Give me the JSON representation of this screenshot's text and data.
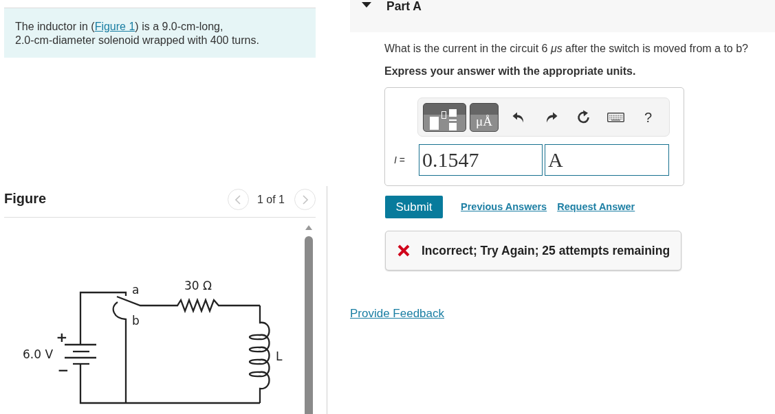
{
  "problem": {
    "text_before": "The inductor in (",
    "link": "Figure 1",
    "text_after": ") is a 9.0-cm-long, 2.0-cm-diameter solenoid wrapped with 400 turns."
  },
  "figure": {
    "title": "Figure",
    "pager": "1 of 1",
    "previous": {
      "disabled": true
    },
    "next": {
      "disabled": true
    },
    "circuit": {
      "voltage": "6.0 V",
      "plus": "+",
      "minus": "−",
      "switch_a": "a",
      "switch_b": "b",
      "resistance": "30 Ω",
      "inductor": "L"
    }
  },
  "part": {
    "title": "Part A",
    "expanded": true,
    "question": "What is the current in the circuit 6 *μs* after the switch is moved from a to b?",
    "instruction": "Express your answer with the appropriate units.",
    "toolbar": {
      "units_label": "μÅ",
      "help_label": "?"
    },
    "answer": {
      "label": "*I* =",
      "value": "0.1547",
      "units": "A"
    },
    "submit": "Submit",
    "links": [
      "Previous Answers",
      "Request Answer"
    ],
    "feedback": {
      "kind": "incorrect",
      "text": "Incorrect; Try Again; 25 attempts remaining"
    }
  },
  "footer_link": "Provide Feedback"
}
